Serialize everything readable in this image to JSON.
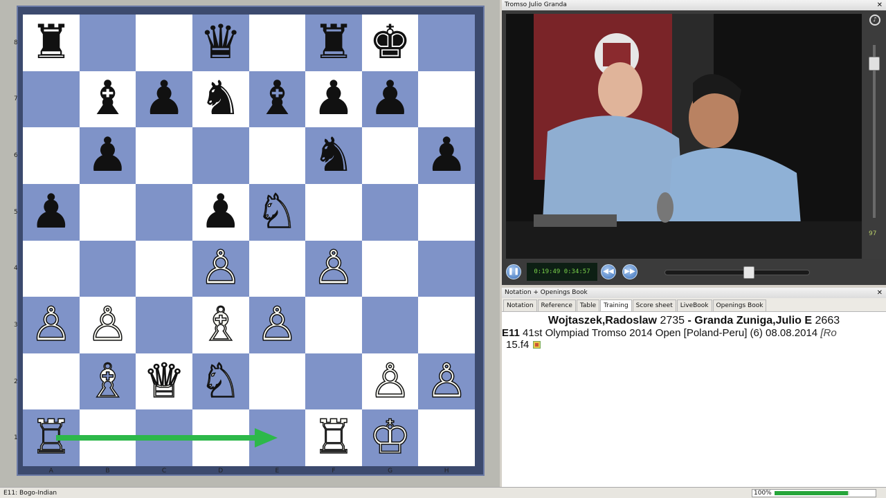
{
  "board": {
    "ranks": [
      "8",
      "7",
      "6",
      "5",
      "4",
      "3",
      "2",
      "1"
    ],
    "files": [
      "A",
      "B",
      "C",
      "D",
      "E",
      "F",
      "G",
      "H"
    ],
    "squares": [
      [
        "♜",
        "",
        "",
        "♛",
        "",
        "♜",
        "♚",
        ""
      ],
      [
        "",
        "♝",
        "♟",
        "♞",
        "♝",
        "♟",
        "♟",
        ""
      ],
      [
        "",
        "♟",
        "",
        "",
        "",
        "♞",
        "",
        "♟"
      ],
      [
        "♟",
        "",
        "",
        "♟",
        "♘",
        "",
        "",
        ""
      ],
      [
        "",
        "",
        "",
        "♙",
        "",
        "♙",
        "",
        ""
      ],
      [
        "♙",
        "♙",
        "",
        "♗",
        "♙",
        "",
        "",
        ""
      ],
      [
        "",
        "♗",
        "♕",
        "♘",
        "",
        "",
        "♙",
        "♙"
      ],
      [
        "♖",
        "",
        "",
        "",
        "",
        "♖",
        "♔",
        ""
      ]
    ],
    "colors": [
      [
        "b",
        "",
        "",
        "b",
        "",
        "b",
        "b",
        ""
      ],
      [
        "",
        "b",
        "b",
        "b",
        "b",
        "b",
        "b",
        ""
      ],
      [
        "",
        "b",
        "",
        "",
        "",
        "b",
        "",
        "b"
      ],
      [
        "b",
        "",
        "",
        "b",
        "w",
        "",
        "",
        ""
      ],
      [
        "",
        "",
        "",
        "w",
        "",
        "w",
        "",
        ""
      ],
      [
        "w",
        "w",
        "",
        "w",
        "w",
        "",
        "",
        ""
      ],
      [
        "",
        "w",
        "w",
        "w",
        "",
        "",
        "w",
        "w"
      ],
      [
        "w",
        "",
        "",
        "",
        "",
        "w",
        "w",
        ""
      ]
    ],
    "arrow_color": "#2db84a"
  },
  "status": {
    "opening": "E11: Bogo-Indian",
    "zoom": "100%",
    "zoom_fraction": 0.98
  },
  "video": {
    "title": "Tromso Julio Granda",
    "time": "0:19:49 0:34:57",
    "progress_fraction": 0.58,
    "volume": "97"
  },
  "notation": {
    "title": "Notation + Openings Book",
    "tabs": [
      "Notation",
      "Reference",
      "Table",
      "Training",
      "Score sheet",
      "LiveBook",
      "Openings Book"
    ],
    "active_tab": "Training",
    "white_player": "Wojtaszek,Radoslaw",
    "white_elo": "2735",
    "separator": "-",
    "black_player": "Granda Zuniga,Julio E",
    "black_elo": "2663",
    "eco": "E11",
    "event": "41st Olympiad Tromso 2014 Open [Poland-Peru] (6) 08.08.2014",
    "event_tail": "[Ro",
    "moves": "15.f4"
  }
}
